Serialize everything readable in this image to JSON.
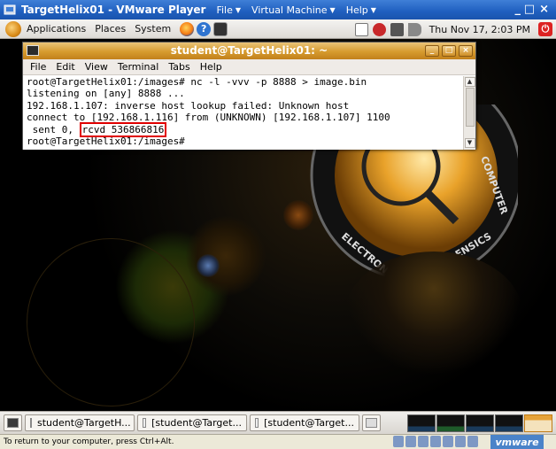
{
  "vm": {
    "title": "TargetHelix01 - VMware Player",
    "menus": [
      "File",
      "Virtual Machine",
      "Help"
    ],
    "controls": {
      "minimize": "_",
      "maximize": "□",
      "close": "×"
    }
  },
  "top_panel": {
    "menus": [
      "Applications",
      "Places",
      "System"
    ],
    "clock": "Thu Nov 17,  2:03 PM"
  },
  "terminal": {
    "title": "student@TargetHelix01: ~",
    "menu": [
      "File",
      "Edit",
      "View",
      "Terminal",
      "Tabs",
      "Help"
    ],
    "lines": [
      "root@TargetHelix01:/images# nc -l -vvv -p 8888 > image.bin",
      "listening on [any] 8888 ...",
      "192.168.1.107: inverse host lookup failed: Unknown host",
      "connect to [192.168.1.116] from (UNKNOWN) [192.168.1.107] 1100"
    ],
    "sent_prefix": " sent 0, ",
    "rcvd": "rcvd 536866816",
    "prompt": "root@TargetHelix01:/images#"
  },
  "bottom_panel": {
    "tasks": [
      "student@TargetH...",
      "[student@Target...",
      "[student@Target..."
    ]
  },
  "status": {
    "hint": "To return to your computer, press Ctrl+Alt.",
    "brand": "vmware"
  },
  "colors": {
    "vm_titlebar": "#1f5fbf",
    "terminal_titlebar": "#d69b2e",
    "highlight_box": "#e00000"
  },
  "icons": {
    "start": "gnome-foot-logo",
    "firefox": "firefox-icon",
    "help": "help-icon",
    "terminal": "terminal-icon",
    "shutdown": "shutdown-icon"
  }
}
